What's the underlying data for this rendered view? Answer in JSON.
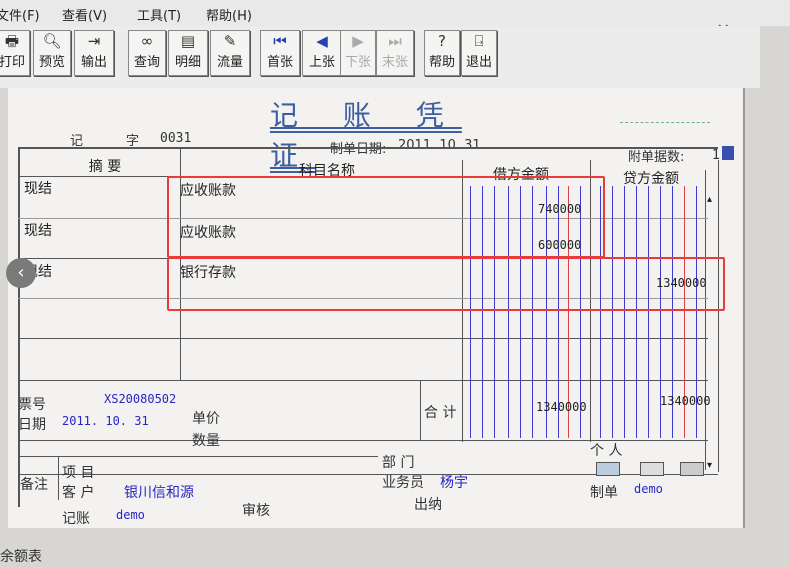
{
  "menu": [
    "文件(F)",
    "查看(V)",
    "工具(T)",
    "帮助(H)"
  ],
  "toolbar": {
    "print": "打印",
    "preview": "预览",
    "export": "输出",
    "query": "查询",
    "detail": "明细",
    "flow": "流量",
    "first": "首张",
    "prev": "上张",
    "next": "下张",
    "last": "末张",
    "help": "帮助",
    "exit": "退出"
  },
  "voucher": {
    "title": "记 账 凭 证",
    "type_label": "记",
    "no_label": "字",
    "number": "0031",
    "date_label": "制单日期:",
    "date_value": "2011. 10. 31",
    "attach_label": "附单据数:",
    "attach_value": "1"
  },
  "headers": {
    "summary": "摘 要",
    "account": "科目名称",
    "debit": "借方金额",
    "credit": "贷方金额"
  },
  "entries": [
    {
      "summary": "现结",
      "account": "应收账款",
      "debit": "740000",
      "credit": ""
    },
    {
      "summary": "现结",
      "account": "应收账款",
      "debit": "600000",
      "credit": ""
    },
    {
      "summary": "现结",
      "account": "银行存款",
      "debit": "",
      "credit": "1340000"
    }
  ],
  "footer": {
    "ticket_label": "票号",
    "ticket_value": "XS20080502",
    "date_label": "日期",
    "date_value": "2011. 10. 31",
    "unit_price_label": "单价",
    "quantity_label": "数量",
    "total_label": "合 计",
    "total_debit": "1340000",
    "total_credit": "1340000",
    "remark_label": "备注",
    "project_label": "项 目",
    "customer_label": "客 户",
    "customer_value": "银川信和源",
    "dept_label": "部 门",
    "person_label": "个 人",
    "salesman_label": "业务员",
    "salesman_value": "杨宇",
    "bookkeeper_label": "记账",
    "bookkeeper_value": "demo",
    "auditor_label": "审核",
    "cashier_label": "出纳",
    "maker_label": "制单",
    "maker_value": "demo"
  },
  "bottom_text": "余额表"
}
